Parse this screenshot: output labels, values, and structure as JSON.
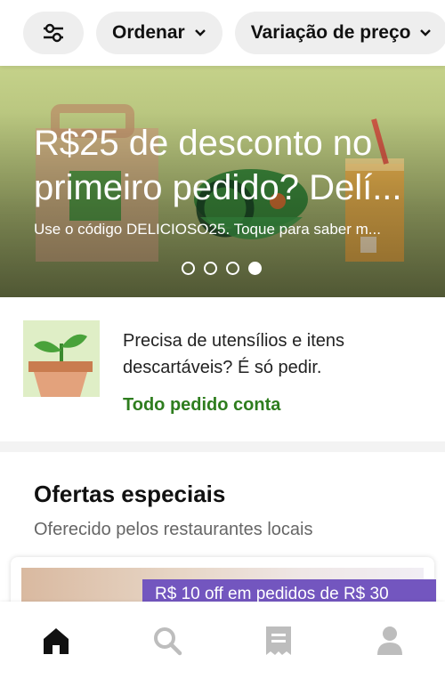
{
  "filters": {
    "settings_icon": "sliders-icon",
    "sort_label": "Ordenar",
    "price_label": "Variação de preço"
  },
  "banner": {
    "title_line1": "R$25 de desconto no",
    "title_line2": "primeiro pedido? Delí...",
    "subtitle": "Use o código DELICIOSO25. Toque para saber m...",
    "dots_total": 4,
    "dots_active": 4
  },
  "utensils": {
    "text": "Precisa de utensílios e itens descartáveis? É só pedir.",
    "link": "Todo pedido conta",
    "link_color": "#2e7d1e"
  },
  "offers": {
    "title": "Ofertas especiais",
    "subtitle": "Oferecido pelos restaurantes locais",
    "badge": "R$ 10 off em pedidos de R$ 30",
    "badge_color": "#7356bf"
  },
  "bottom_nav": {
    "items": [
      {
        "icon": "home-icon",
        "active": true
      },
      {
        "icon": "search-icon",
        "active": false
      },
      {
        "icon": "receipt-icon",
        "active": false
      },
      {
        "icon": "account-icon",
        "active": false
      }
    ]
  }
}
